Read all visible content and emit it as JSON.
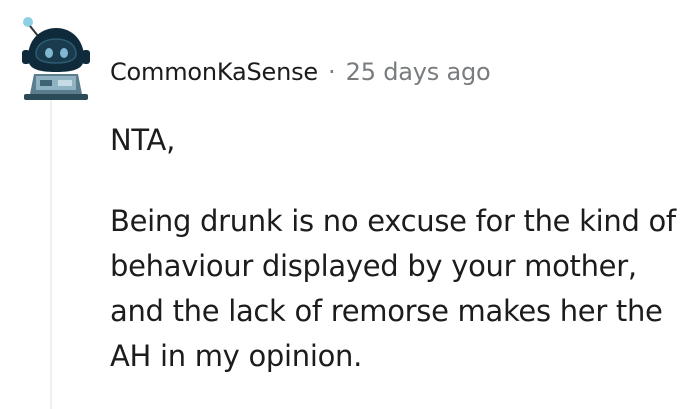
{
  "comment": {
    "author": "CommonKaSense",
    "separator": "·",
    "timestamp": "25 days ago",
    "avatar_icon": "snoo-avatar-icon",
    "paragraphs": [
      "NTA,",
      "Being drunk is no excuse for the kind of behaviour displayed by your mother, and the lack of remorse makes her the AH in my opinion."
    ]
  },
  "colors": {
    "text": "#1c1c1c",
    "meta": "#787c7e",
    "thread_line": "#edeff1",
    "avatar_primary": "#0f2a3a",
    "avatar_accent": "#7fb8d0"
  }
}
